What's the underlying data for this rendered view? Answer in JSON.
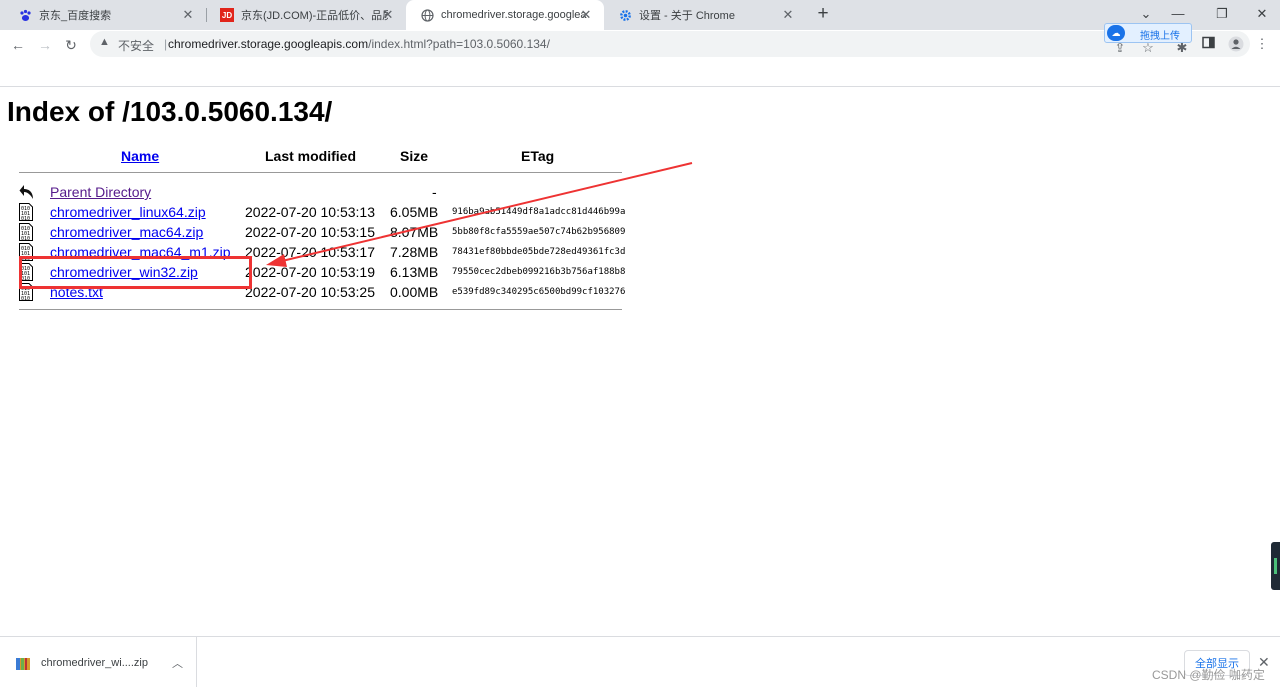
{
  "tabs": [
    {
      "title": "京东_百度搜索",
      "icon": "baidu-paw-icon",
      "active": false
    },
    {
      "title": "京东(JD.COM)-正品低价、品质保障",
      "icon": "jd-logo-icon",
      "icon_text": "JD",
      "active": false
    },
    {
      "title": "chromedriver.storage.googleapis.com",
      "icon": "globe-icon",
      "active": true
    },
    {
      "title": "设置 - 关于 Chrome",
      "icon": "settings-gear-icon",
      "active": false
    }
  ],
  "toolbar": {
    "security_label": "不安全",
    "separator": "|",
    "url_host": "chromedriver.storage.googleapis.com",
    "url_path": "/index.html?path=103.0.5060.134/",
    "upload_label": "拖拽上传"
  },
  "page": {
    "title": "Index of /103.0.5060.134/",
    "columns": {
      "name": "Name",
      "last_modified": "Last modified",
      "size": "Size",
      "etag": "ETag"
    },
    "rows": [
      {
        "name": "Parent Directory",
        "date": "",
        "size": "-",
        "etag": "",
        "icon": "back-arrow-icon",
        "visited": true
      },
      {
        "name": "chromedriver_linux64.zip",
        "date": "2022-07-20 10:53:13",
        "size": "6.05MB",
        "etag": "916ba9ab51449df8a1adcc81d446b99a",
        "icon": "binary-file-icon"
      },
      {
        "name": "chromedriver_mac64.zip",
        "date": "2022-07-20 10:53:15",
        "size": "8.07MB",
        "etag": "5bb80f8cfa5559ae507c74b62b956809",
        "icon": "binary-file-icon"
      },
      {
        "name": "chromedriver_mac64_m1.zip",
        "date": "2022-07-20 10:53:17",
        "size": "7.28MB",
        "etag": "78431ef80bbde05bde728ed49361fc3d",
        "icon": "binary-file-icon"
      },
      {
        "name": "chromedriver_win32.zip",
        "date": "2022-07-20 10:53:19",
        "size": "6.13MB",
        "etag": "79550cec2dbeb099216b3b756af188b8",
        "icon": "binary-file-icon"
      },
      {
        "name": "notes.txt",
        "date": "2022-07-20 10:53:25",
        "size": "0.00MB",
        "etag": "e539fd89c340295c6500bd99cf103276",
        "icon": "binary-file-icon"
      }
    ]
  },
  "download_bar": {
    "file_name": "chromedriver_wi....zip",
    "show_all_label": "全部显示",
    "watermark": "CSDN @勤俭 咖药定"
  },
  "colors": {
    "link": "#0000ee",
    "visited": "#551a8b",
    "annotation": "#ee3333",
    "tabstrip": "#dee1e6"
  }
}
